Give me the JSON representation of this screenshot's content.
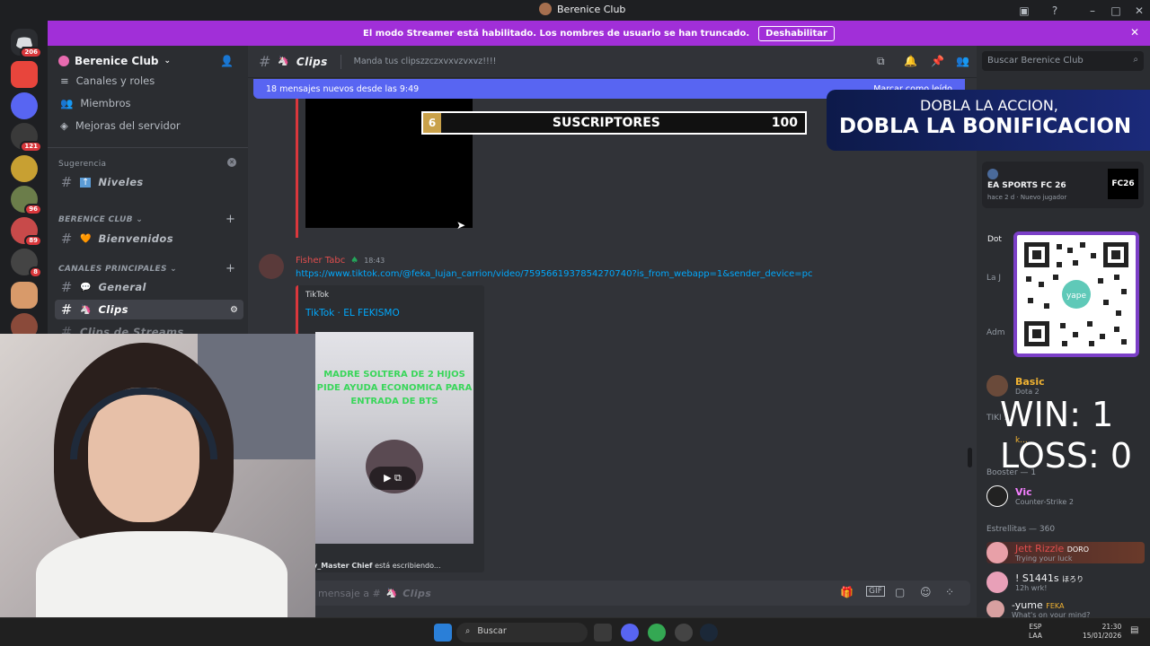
{
  "window": {
    "title": "Berenice Club"
  },
  "banner": {
    "text": "El modo Streamer está habilitado. Los nombres de usuario se han truncado.",
    "button": "Deshabilitar"
  },
  "guild_badges": [
    "206",
    "121",
    "96",
    "89",
    "8"
  ],
  "sidebar": {
    "server_name": "Berenice Club",
    "items": [
      {
        "label": "Canales y roles"
      },
      {
        "label": "Miembros"
      },
      {
        "label": "Mejoras del servidor"
      }
    ],
    "suggestion_label": "Sugerencia",
    "suggestion_channel": "Niveles",
    "cat1": "BERENICE CLUB",
    "chan_bienvenidos": "Bienvenidos",
    "cat2": "CANALES PRINCIPALES",
    "chan_general": "General",
    "chan_clips": "Clips",
    "chan_clips_streams": "Clips de Streams"
  },
  "chat": {
    "channel": "Clips",
    "topic": "Manda tus clipszzczxvxvzvxvz!!!!",
    "new_messages": "18 mensajes nuevos desde las 9:49",
    "mark_read": "Marcar como leído",
    "message_author": "Fisher Tabc",
    "message_time": "18:43",
    "link": "https://www.tiktok.com/@feka_lujan_carrion/video/7595661937854270740?is_from_webapp=1&sender_device=pc",
    "embed_provider": "TikTok",
    "embed_title": "TikTok · EL FEKISMO",
    "video_caption": "MADRE SOLTERA DE 2 HIJOS PIDE AYUDA ECONOMICA PARA ENTRADA DE BTS",
    "typing_user": "y_Master Chief",
    "typing_suffix": "está escribiendo...",
    "input_placeholder": "r mensaje a #",
    "input_channel": "Clips"
  },
  "search": {
    "placeholder": "Buscar Berenice Club"
  },
  "overlays": {
    "sub_count": "6",
    "sub_label": "SUSCRIPTORES",
    "sub_goal": "100",
    "promo_line1": "DOBLA LA ACCION,",
    "promo_line2": "DOBLA LA BONIFICACION",
    "win": "WIN: 1",
    "loss": "LOSS: 0"
  },
  "members": {
    "ea_title": "EA SPORTS FC 26",
    "ea_time": "hace 2 d",
    "ea_status": "Nuevo jugador",
    "dot_label": "Dot",
    "la_label": "La J",
    "adm_label": "Adm",
    "basic_name": "Basic",
    "basic_game": "Dota 2",
    "tiki_label": "TIKI ...",
    "k_label": "k...",
    "booster_header": "Booster — 1",
    "vic_name": "Vic",
    "vic_game": "Counter-Strike 2",
    "estrellitas_header": "Estrellitas — 360",
    "m1_name": "Jett Rizzle",
    "m1_tag": "DORO",
    "m1_sub": "Trying your luck",
    "m2_name": "! S1441s",
    "m2_tag": "ほろり",
    "m2_sub": "12h wrk!",
    "m3_name": "-yume",
    "m3_tag": "FEKA",
    "m3_sub": "What's on your mind?"
  },
  "taskbar": {
    "search": "Buscar",
    "lang1": "ESP",
    "lang2": "LAA",
    "time": "21:30",
    "date": "15/01/2026"
  },
  "colors": {
    "accent": "#5865f2",
    "banner": "#a12fd8",
    "gold": "#c9a14a"
  }
}
